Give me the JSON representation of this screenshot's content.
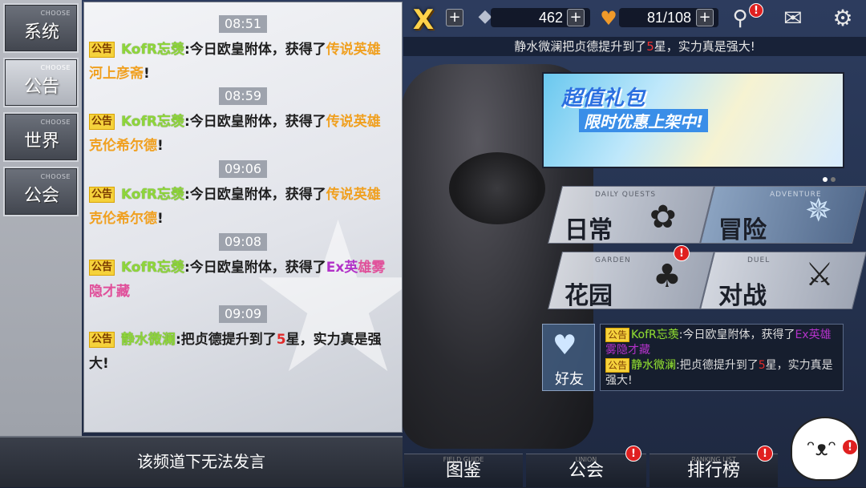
{
  "topbar": {
    "close_label": "X",
    "diamonds": "462",
    "stamina": "81/108",
    "plus": "+",
    "notif_badge": "!"
  },
  "marquee": {
    "pre": "静水微澜把贞德提升到了",
    "num": "5",
    "post": "星，实力真是强大!"
  },
  "banner": {
    "line1": "超值礼包",
    "line2": "限时优惠上架中!"
  },
  "modes": {
    "daily_en": "DAILY QUESTS",
    "daily_cn": "日常",
    "adventure_en": "ADVENTURE",
    "adventure_cn": "冒险",
    "garden_en": "GARDEN",
    "garden_cn": "花园",
    "duel_en": "DUEL",
    "duel_cn": "对战"
  },
  "friends": {
    "label": "好友"
  },
  "mini_chat": {
    "tag": "公告",
    "l1_user": "KofR忘羡",
    "l1_text": ":今日欧皇附体，获得了",
    "l1_item": "Ex英雄雾隐才藏",
    "l2_user": "静水微澜",
    "l2_text": ":把贞德提升到了",
    "l2_num": "5",
    "l2_post": "星，实力真是强大!"
  },
  "bottom_nav": {
    "atlas": "图鉴",
    "atlas_en": "FIELD GUIDE",
    "guild": "公会",
    "guild_en": "UNION",
    "ranking": "排行榜",
    "ranking_en": "RANKING LIST"
  },
  "sidebar": {
    "choose": "CHOOSE",
    "tabs": [
      "系统",
      "公告",
      "世界",
      "公会"
    ]
  },
  "chat": {
    "tag": "公告",
    "messages": [
      {
        "time": "08:51",
        "user": "KofR忘羡",
        "text": ":今日欧皇附体，获得了",
        "item": "传说英雄河上彦斋",
        "end": "!"
      },
      {
        "time": "08:59",
        "user": "KofR忘羡",
        "text": ":今日欧皇附体，获得了",
        "item": "传说英雄克伦希尔德",
        "end": "!"
      },
      {
        "time": "09:06",
        "user": "KofR忘羡",
        "text": ":今日欧皇附体，获得了",
        "item": "传说英雄克伦希尔德",
        "end": "!"
      },
      {
        "time": "09:08",
        "user": "KofR忘羡",
        "text": ":今日欧皇附体，获得了",
        "item_a": "Ex英",
        "item_b": "雄雾隐才藏"
      },
      {
        "time": "09:09",
        "user": "静水微澜",
        "text": ":把贞德提升到了",
        "num": "5",
        "post": "星，实力真是强大!"
      }
    ]
  },
  "input_bar": {
    "text": "该频道下无法发言"
  },
  "colors": {
    "username": "#8ed63a",
    "legend_item": "#f0a020",
    "ex_item": "#b232c8",
    "highlight_red": "#e02a2a",
    "tag_bg": "#f5d23c"
  }
}
